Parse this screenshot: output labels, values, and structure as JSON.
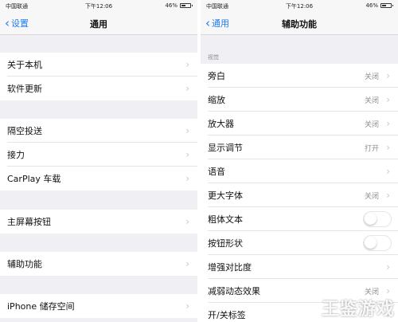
{
  "left": {
    "status": {
      "carrier": "中国联通",
      "time": "下午12:06",
      "battery": "46%"
    },
    "nav": {
      "back": "设置",
      "title": "通用"
    },
    "rows": [
      {
        "label": "关于本机"
      },
      {
        "label": "软件更新"
      },
      {
        "label": "隔空投送"
      },
      {
        "label": "接力"
      },
      {
        "label": "CarPlay 车载"
      },
      {
        "label": "主屏幕按钮"
      },
      {
        "label": "辅助功能"
      },
      {
        "label": "iPhone 储存空间"
      }
    ]
  },
  "right": {
    "status": {
      "carrier": "中国联通",
      "time": "下午12:06",
      "battery": "46%"
    },
    "nav": {
      "back": "通用",
      "title": "辅助功能"
    },
    "section_header": "视觉",
    "rows": [
      {
        "label": "旁白",
        "value": "关闭"
      },
      {
        "label": "缩放",
        "value": "关闭"
      },
      {
        "label": "放大器",
        "value": "关闭"
      },
      {
        "label": "显示调节",
        "value": "打开"
      },
      {
        "label": "语音",
        "value": ""
      },
      {
        "label": "更大字体",
        "value": "关闭"
      },
      {
        "label": "粗体文本",
        "value": ""
      },
      {
        "label": "按钮形状",
        "value": ""
      },
      {
        "label": "增强对比度",
        "value": ""
      },
      {
        "label": "减弱动态效果",
        "value": "关闭"
      },
      {
        "label": "开/关标签",
        "value": ""
      }
    ]
  },
  "icons": {
    "back": "chevron-left-icon",
    "disclosure": "chevron-right-icon",
    "wifi": "wifi-icon",
    "battery": "battery-icon"
  },
  "colors": {
    "accent": "#1e7cf2",
    "background": "#efeff4",
    "chevron": "#c7c7cc",
    "value_text": "#8e8e93"
  },
  "toggles": {
    "bold_text": false,
    "button_shapes": false
  },
  "watermark": "王鉴游戏"
}
